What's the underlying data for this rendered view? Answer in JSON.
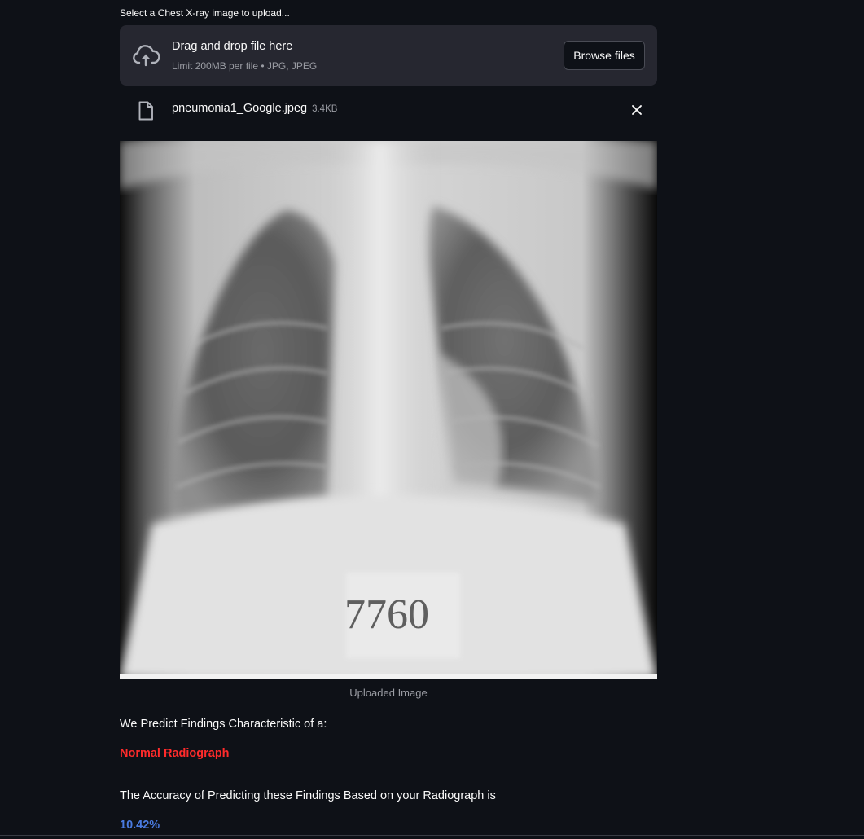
{
  "uploader": {
    "label": "Select a Chest X-ray image to upload...",
    "dropzone_title": "Drag and drop file here",
    "dropzone_subtitle": "Limit 200MB per file • JPG, JPEG",
    "browse_label": "Browse files"
  },
  "file": {
    "name": "pneumonia1_Google.jpeg",
    "size": "3.4KB"
  },
  "image": {
    "marker_text": "7760",
    "caption": "Uploaded Image"
  },
  "results": {
    "predict_text": "We Predict Findings Characteristic of a:",
    "result_label": "Normal Radiograph",
    "accuracy_text": "The Accuracy of Predicting these Findings Based on your Radiograph is",
    "accuracy_value": "10.42%"
  },
  "colors": {
    "background": "#0e1117",
    "dropzone": "#262730",
    "result_red": "#ff2b2b",
    "accuracy_blue": "#4a7be0",
    "muted_text": "#9a9ca3"
  },
  "icons": {
    "upload": "cloud-upload-icon",
    "file": "file-icon",
    "remove": "close-icon"
  }
}
